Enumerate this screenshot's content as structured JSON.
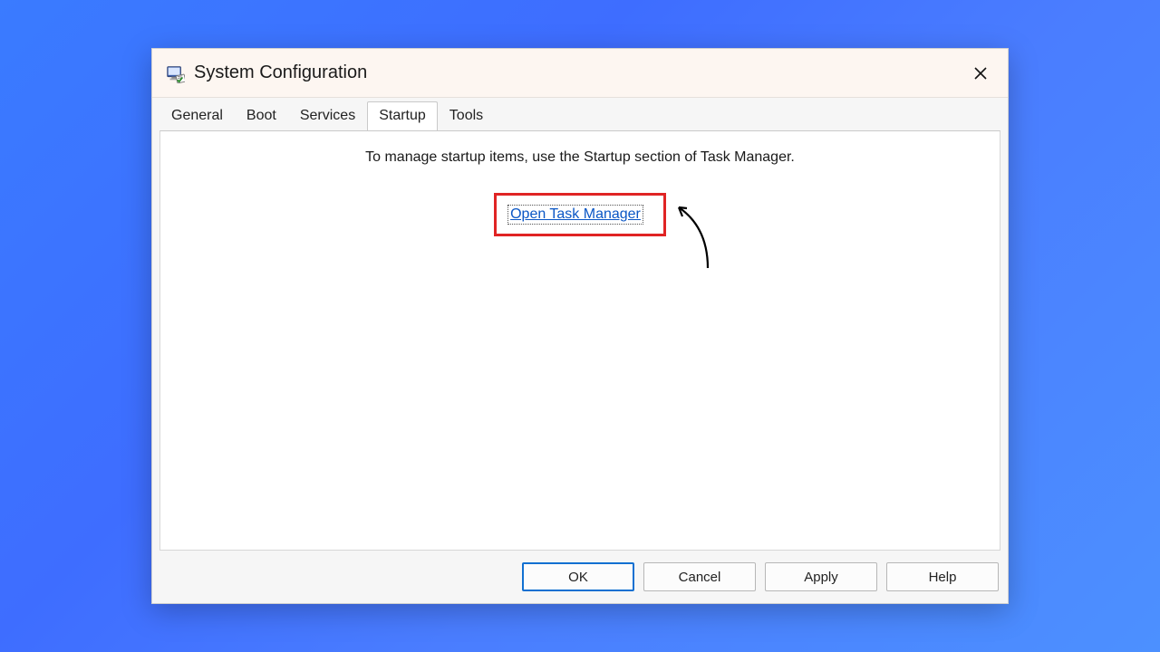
{
  "titlebar": {
    "title": "System Configuration"
  },
  "tabs": {
    "items": [
      {
        "label": "General"
      },
      {
        "label": "Boot"
      },
      {
        "label": "Services"
      },
      {
        "label": "Startup",
        "active": true
      },
      {
        "label": "Tools"
      }
    ]
  },
  "content": {
    "info_text": "To manage startup items, use the Startup section of Task Manager.",
    "link_text": "Open Task Manager"
  },
  "buttons": {
    "ok": "OK",
    "cancel": "Cancel",
    "apply": "Apply",
    "help": "Help"
  }
}
